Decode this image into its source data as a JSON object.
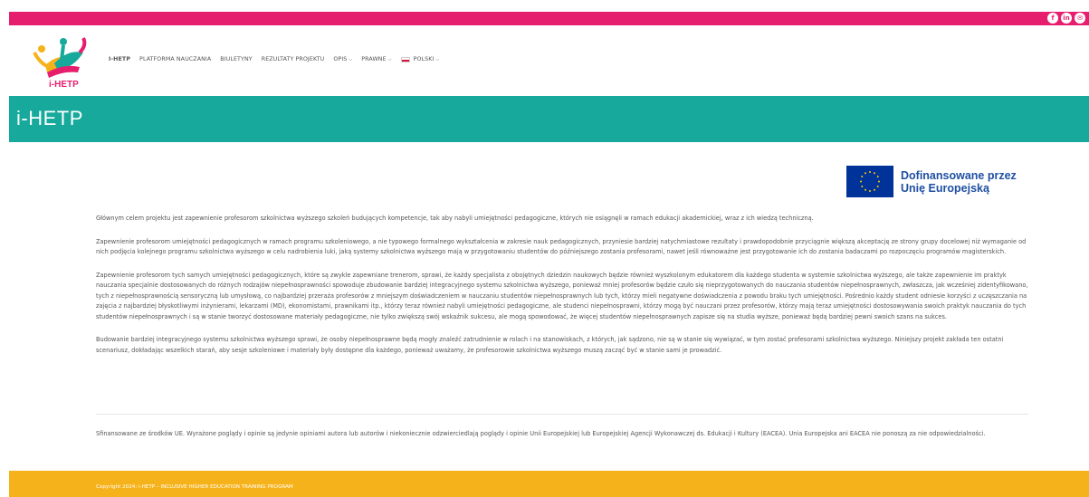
{
  "social": [
    "f",
    "in",
    "✉"
  ],
  "logo": {
    "text": "i-HETP"
  },
  "nav": {
    "items": [
      {
        "label": "I-HETP",
        "active": true
      },
      {
        "label": "PLATFORMA NAUCZANIA"
      },
      {
        "label": "BIULETYNY"
      },
      {
        "label": "REZULTATY PROJEKTU"
      },
      {
        "label": "OPIS",
        "dropdown": true
      },
      {
        "label": "PRAWNE",
        "dropdown": true
      },
      {
        "label": "POLSKI",
        "dropdown": true
      }
    ]
  },
  "page": {
    "title": "i-HETP"
  },
  "eu": {
    "line1": "Dofinansowane przez",
    "line2": "Unię Europejską"
  },
  "content": {
    "paragraphs": [
      "Głównym celem projektu jest zapewnienie profesorom szkolnictwa wyższego szkoleń budujących kompetencje, tak aby nabyli umiejętności pedagogiczne, których nie osiągnęli w ramach edukacji akademickiej, wraz z ich wiedzą techniczną.",
      "Zapewnienie profesorom umiejętności pedagogicznych w ramach programu szkoleniowego, a nie typowego formalnego wykształcenia w zakresie nauk pedagogicznych, przyniesie bardziej natychmiastowe rezultaty i prawdopodobnie przyciągnie większą akceptację ze strony grupy docelowej niż wymaganie od nich podjęcia kolejnego programu szkolnictwa wyższego w celu nadrobienia luki, jaką systemy szkolnictwa wyższego mają w przygotowaniu studentów do późniejszego zostania profesorami, nawet jeśli równoważne jest przygotowanie ich do zostania badaczami po rozpoczęciu programów magisterskich.",
      "Zapewnienie profesorom tych samych umiejętności pedagogicznych, które są zwykle zapewniane trenerom, sprawi, że każdy specjalista z obojętnych dziedzin naukowych będzie również wyszkolonym edukatorem dla każdego studenta w systemie szkolnictwa wyższego, ale także zapewnienie im praktyk nauczania specjalnie dostosowanych do różnych rodzajów niepełnosprawności spowoduje zbudowanie bardziej integracyjnego systemu szkolnictwa wyższego, ponieważ mniej profesorów będzie czuło się nieprzygotowanych do nauczania studentów niepełnosprawnych, zwłaszcza, jak wcześniej zidentyfikowano, tych z niepełnosprawnością sensoryczną lub umysłową, co najbardziej przeraża profesorów z mniejszym doświadczeniem w nauczaniu studentów niepełnosprawnych lub tych, którzy mieli negatywne doświadczenia z powodu braku tych umiejętności. Pośrednio każdy student odniesie korzyści z uczęszczania na zajęcia z najbardziej błyskotliwymi inżynierami, lekarzami (MD), ekonomistami, prawnikami itp., którzy teraz również nabyli umiejętności pedagogiczne, ale studenci niepełnosprawni, którzy mogą być nauczani przez profesorów, którzy mają teraz umiejętności dostosowywania swoich praktyk nauczania do tych studentów niepełnosprawnych i są w stanie tworzyć dostosowane materiały pedagogiczne, nie tylko zwiększą swój wskaźnik sukcesu, ale mogą spowodować, że więcej studentów niepełnosprawnych zapisze się na studia wyższe, ponieważ będą bardziej pewni swoich szans na sukces.",
      "Budowanie bardziej integracyjnego systemu szkolnictwa wyższego sprawi, że osoby niepełnosprawne będą mogły znaleźć zatrudnienie w rolach i na stanowiskach, z których, jak sądzono, nie są w stanie się wywiązać, w tym zostać profesorami szkolnictwa wyższego. Niniejszy projekt zakłada ten ostatni scenariusz, dokładając wszelkich starań, aby sesje szkoleniowe i materiały były dostępne dla każdego, ponieważ uważamy, że profesorowie szkolnictwa wyższego muszą zacząć być w stanie sami je prowadzić."
    ]
  },
  "disclaimer": "Sfinansowane ze środków UE. Wyrażone poglądy i opinie są jedynie opiniami autora lub autorów i niekoniecznie odzwierciedlają poglądy i opinie Unii Europejskiej lub Europejskiej Agencji Wykonawczej ds. Edukacji i Kultury (EACEA). Unia Europejska ani EACEA nie ponoszą za nie odpowiedzialności.",
  "footer": {
    "copyright": "Copyright 2024: i-HETP – INCLUSIVE HIGHER EDUCATION TRAINING PROGRAM"
  },
  "colors": {
    "topbar": "#e61e6e",
    "teal": "#17a99b",
    "footer": "#f6b21a",
    "eu_blue": "#003399"
  }
}
